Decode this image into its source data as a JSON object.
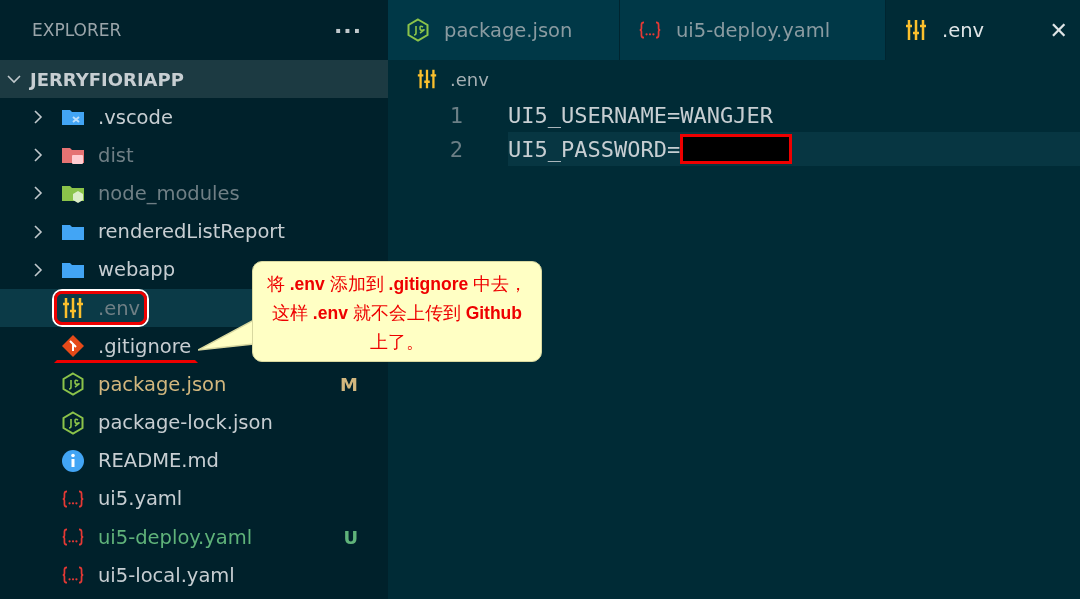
{
  "sidebar": {
    "title": "EXPLORER",
    "more": "···",
    "root": {
      "label": "JERRYFIORIAPP",
      "expanded": true,
      "children": [
        {
          "label": ".vscode",
          "kind": "vscode-folder",
          "expanded": false,
          "ignored": false,
          "selected": false,
          "circled": false,
          "underlined": false
        },
        {
          "label": "dist",
          "kind": "dist-folder",
          "expanded": false,
          "ignored": true,
          "selected": false,
          "circled": false,
          "underlined": false
        },
        {
          "label": "node_modules",
          "kind": "node-folder",
          "expanded": false,
          "ignored": true,
          "selected": false,
          "circled": false,
          "underlined": false
        },
        {
          "label": "renderedListReport",
          "kind": "folder",
          "expanded": false,
          "ignored": false,
          "selected": false,
          "circled": false,
          "underlined": false
        },
        {
          "label": "webapp",
          "kind": "folder",
          "expanded": false,
          "ignored": false,
          "selected": false,
          "circled": false,
          "underlined": false
        },
        {
          "label": ".env",
          "kind": "env",
          "ignored": true,
          "selected": true,
          "circled": true,
          "underlined": false
        },
        {
          "label": ".gitignore",
          "kind": "git",
          "ignored": false,
          "selected": false,
          "circled": false,
          "underlined": true
        },
        {
          "label": "package.json",
          "kind": "js",
          "ignored": false,
          "selected": false,
          "circled": false,
          "underlined": false,
          "status": "M"
        },
        {
          "label": "package-lock.json",
          "kind": "js",
          "ignored": false,
          "selected": false,
          "circled": false,
          "underlined": false
        },
        {
          "label": "README.md",
          "kind": "info",
          "ignored": false,
          "selected": false,
          "circled": false,
          "underlined": false
        },
        {
          "label": "ui5.yaml",
          "kind": "yaml",
          "ignored": false,
          "selected": false,
          "circled": false,
          "underlined": false
        },
        {
          "label": "ui5-deploy.yaml",
          "kind": "yaml",
          "ignored": false,
          "selected": false,
          "circled": false,
          "underlined": false,
          "status": "U"
        },
        {
          "label": "ui5-local.yaml",
          "kind": "yaml",
          "ignored": false,
          "selected": false,
          "circled": false,
          "underlined": false
        }
      ]
    }
  },
  "tabs": [
    {
      "label": "package.json",
      "kind": "js",
      "selected": false
    },
    {
      "label": "ui5-deploy.yaml",
      "kind": "yaml",
      "selected": false
    },
    {
      "label": ".env",
      "kind": "env",
      "selected": true,
      "close": "✕"
    }
  ],
  "breadcrumb": {
    "label": ".env",
    "kind": "env"
  },
  "code": [
    {
      "number": "1",
      "text": "UI5_USERNAME=WANGJER",
      "current": false,
      "redacted": false
    },
    {
      "number": "2",
      "text": "UI5_PASSWORD=",
      "current": true,
      "redacted": true
    }
  ],
  "callout": {
    "text": "将 **.env** 添加到 **.gitignore** 中去，这样 **.env** 就不会上传到 **Github** 上了。"
  }
}
